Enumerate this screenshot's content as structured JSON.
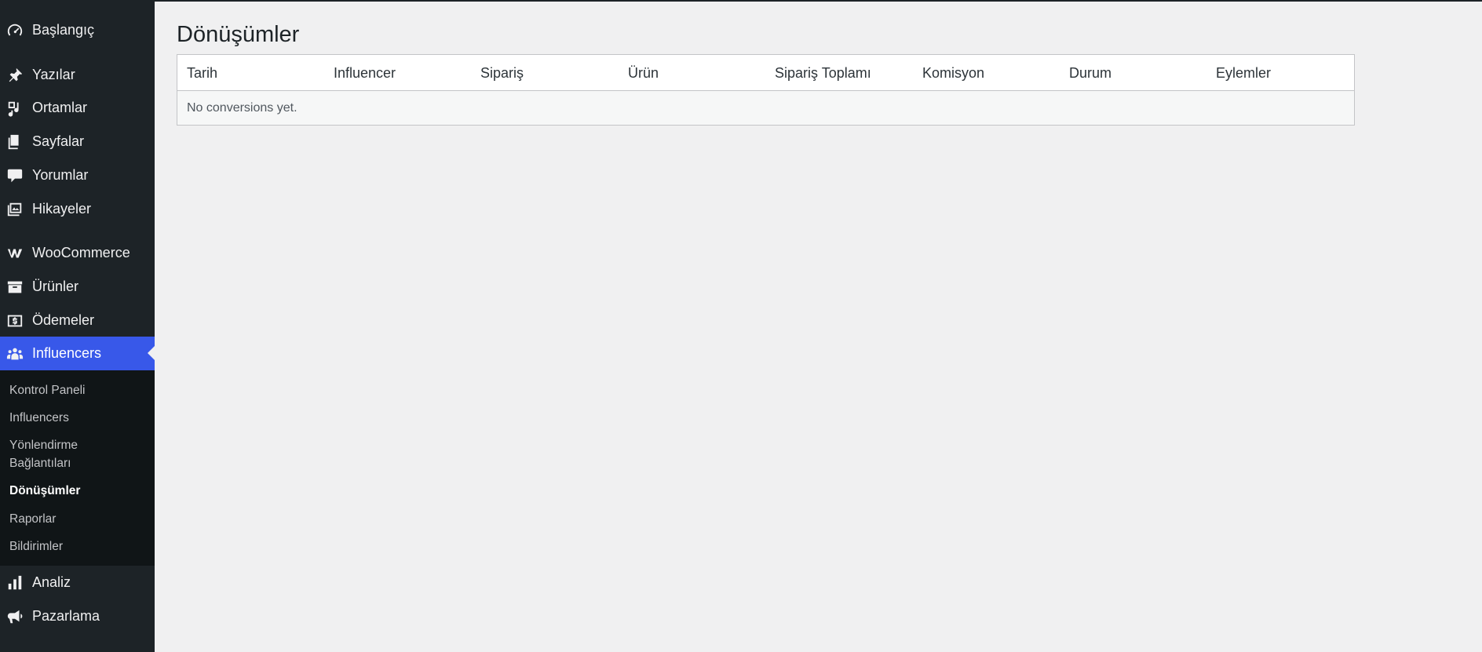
{
  "sidebar": {
    "items": [
      {
        "label": "Başlangıç",
        "icon": "dashboard-icon"
      },
      {
        "label": "Yazılar",
        "icon": "pin-icon"
      },
      {
        "label": "Ortamlar",
        "icon": "media-icon"
      },
      {
        "label": "Sayfalar",
        "icon": "pages-icon"
      },
      {
        "label": "Yorumlar",
        "icon": "comment-icon"
      },
      {
        "label": "Hikayeler",
        "icon": "stories-icon"
      },
      {
        "label": "WooCommerce",
        "icon": "woocommerce-icon"
      },
      {
        "label": "Ürünler",
        "icon": "archive-icon"
      },
      {
        "label": "Ödemeler",
        "icon": "payment-icon"
      },
      {
        "label": "Influencers",
        "icon": "groups-icon"
      },
      {
        "label": "Analiz",
        "icon": "bar-chart-icon"
      },
      {
        "label": "Pazarlama",
        "icon": "megaphone-icon"
      }
    ],
    "submenu": [
      {
        "label": "Kontrol Paneli"
      },
      {
        "label": "Influencers"
      },
      {
        "label": "Yönlendirme Bağlantıları"
      },
      {
        "label": "Dönüşümler"
      },
      {
        "label": "Raporlar"
      },
      {
        "label": "Bildirimler"
      }
    ]
  },
  "main": {
    "title": "Dönüşümler",
    "table": {
      "columns": [
        "Tarih",
        "Influencer",
        "Sipariş",
        "Ürün",
        "Sipariş Toplamı",
        "Komisyon",
        "Durum",
        "Eylemler"
      ],
      "empty_message": "No conversions yet."
    }
  },
  "colors": {
    "sidebar_bg": "#1d2327",
    "submenu_bg": "#101517",
    "active_accent": "#3858e9",
    "page_bg": "#f0f0f1"
  }
}
